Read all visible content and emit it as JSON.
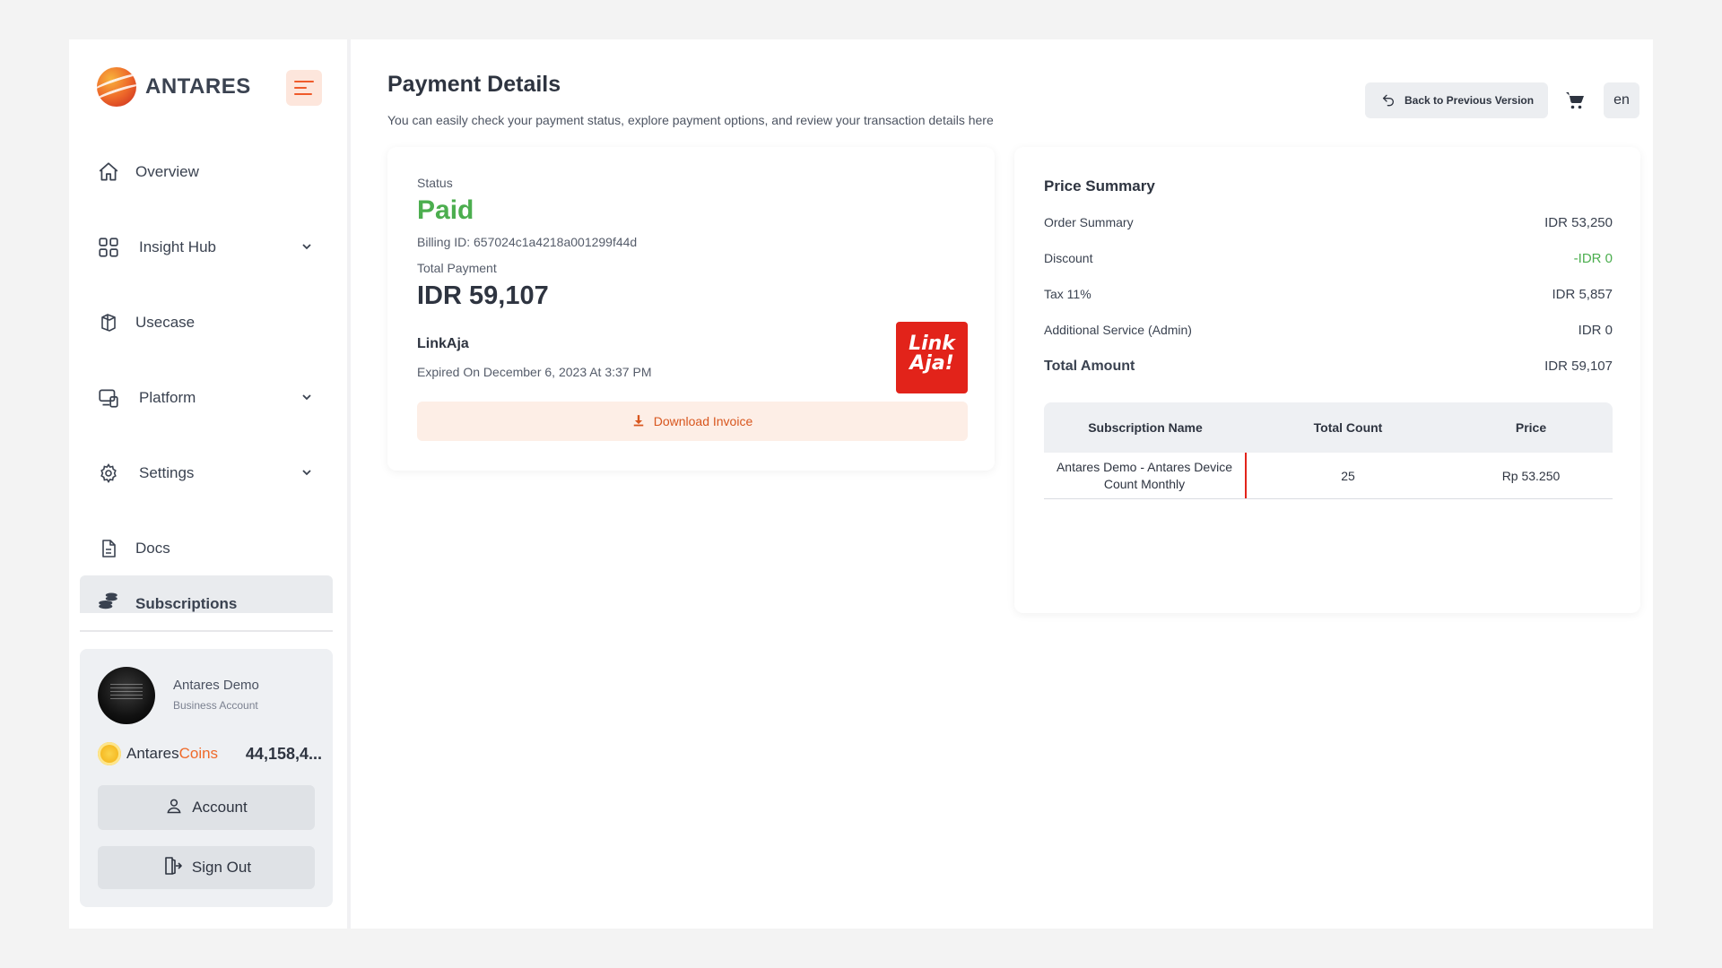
{
  "brand": {
    "name": "ANTARES"
  },
  "sidebar": {
    "items": [
      {
        "label": "Overview"
      },
      {
        "label": "Insight Hub"
      },
      {
        "label": "Usecase"
      },
      {
        "label": "Platform"
      },
      {
        "label": "Settings"
      },
      {
        "label": "Docs"
      },
      {
        "label": "Subscriptions"
      }
    ],
    "profile": {
      "name": "Antares Demo",
      "type": "Business Account",
      "coins_brand_a": "Antares",
      "coins_brand_b": "Coins",
      "coins_value": "44,158,4...",
      "account_label": "Account",
      "signout_label": "Sign Out"
    }
  },
  "header": {
    "title": "Payment Details",
    "subtitle": "You can easily check your payment status, explore payment options, and review your transaction details here",
    "back_label": "Back to Previous Version",
    "lang": "en"
  },
  "payment": {
    "status_label": "Status",
    "status_value": "Paid",
    "billing_id": "Billing ID: 657024c1a4218a001299f44d",
    "total_label": "Total Payment",
    "total_value": "IDR 59,107",
    "method_name": "LinkAja",
    "method_logo_line1": "Link",
    "method_logo_line2": "Aja!",
    "expiry": "Expired On December 6, 2023 At 3:37 PM",
    "download_label": "Download Invoice"
  },
  "summary": {
    "title": "Price Summary",
    "rows": [
      {
        "label": "Order Summary",
        "value": "IDR 53,250"
      },
      {
        "label": "Discount",
        "value": "-IDR 0"
      },
      {
        "label": "Tax 11%",
        "value": "IDR 5,857"
      },
      {
        "label": "Additional Service (Admin)",
        "value": "IDR 0"
      },
      {
        "label": "Total Amount",
        "value": "IDR 59,107"
      }
    ],
    "table": {
      "headers": [
        "Subscription Name",
        "Total Count",
        "Price"
      ],
      "rows": [
        {
          "name": "Antares Demo - Antares Device Count Monthly",
          "count": "25",
          "price": "Rp 53.250"
        }
      ]
    }
  },
  "colors": {
    "accent": "#ef5a2a",
    "paid": "#4cae4f",
    "linkaja": "#e2231a"
  }
}
